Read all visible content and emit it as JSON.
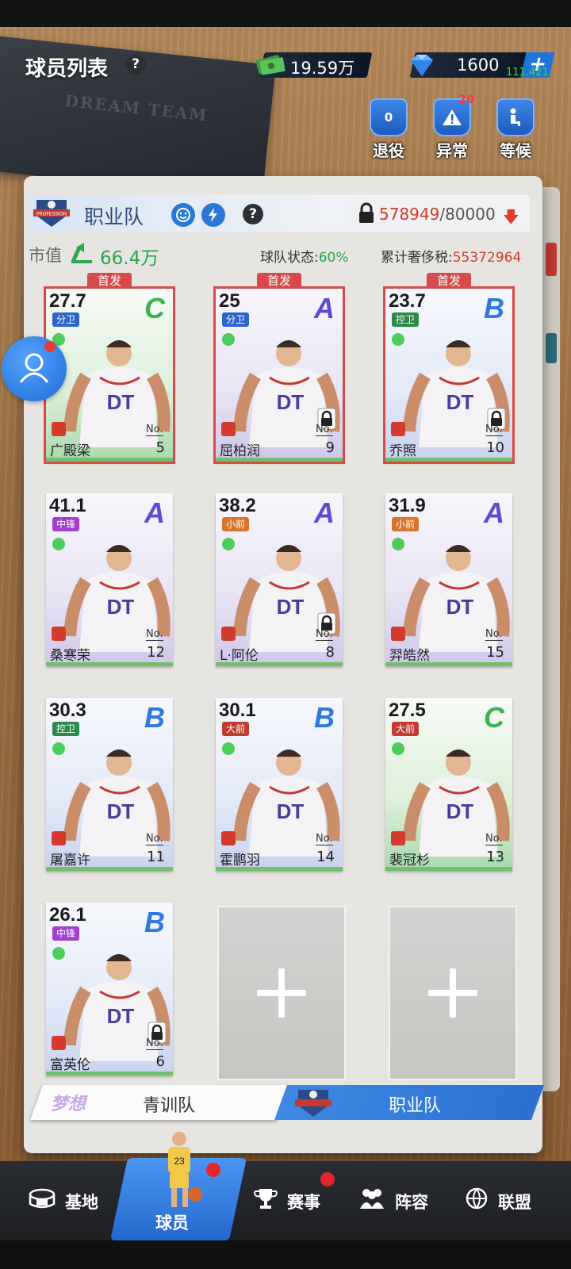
{
  "header": {
    "title": "球员列表",
    "help": "?",
    "money": "19.59万",
    "diamonds": "1600",
    "plus": "+",
    "fps": "111.421"
  },
  "top_actions": [
    {
      "label": "退役",
      "icon": "retire-icon",
      "icon_text": "0"
    },
    {
      "label": "异常",
      "icon": "warning-icon",
      "badge": "20"
    },
    {
      "label": "等候",
      "icon": "waiting-seat-icon"
    }
  ],
  "notebook_text": "DREAM TEAM",
  "team": {
    "name": "职业队",
    "help": "?",
    "salary_used": "578949",
    "salary_cap": "/80000",
    "market_value_label": "市值",
    "market_value": "66.4万",
    "state_label": "球队状态:",
    "state_value": "60%",
    "tax_label": "累计奢侈税:",
    "tax_value": "55372964"
  },
  "starter_tag": "首发",
  "no_label": "No.",
  "players": [
    {
      "rating": "27.7",
      "position": "分卫",
      "grade": "C",
      "name": "广殿梁",
      "number": "5",
      "starter": true,
      "locked": false
    },
    {
      "rating": "25",
      "position": "分卫",
      "grade": "A",
      "name": "屈柏润",
      "number": "9",
      "starter": true,
      "locked": true
    },
    {
      "rating": "23.7",
      "position": "控卫",
      "grade": "B",
      "name": "乔照",
      "number": "10",
      "starter": true,
      "locked": true
    },
    {
      "rating": "41.1",
      "position": "中锋",
      "grade": "A",
      "name": "桑寒荣",
      "number": "12",
      "starter": false,
      "locked": false
    },
    {
      "rating": "38.2",
      "position": "小前",
      "grade": "A",
      "name": "L·阿伦",
      "number": "8",
      "starter": false,
      "locked": true
    },
    {
      "rating": "31.9",
      "position": "小前",
      "grade": "A",
      "name": "羿皓然",
      "number": "15",
      "starter": false,
      "locked": false
    },
    {
      "rating": "30.3",
      "position": "控卫",
      "grade": "B",
      "name": "屠嘉许",
      "number": "11",
      "starter": false,
      "locked": false
    },
    {
      "rating": "30.1",
      "position": "大前",
      "grade": "B",
      "name": "霍鹏羽",
      "number": "14",
      "starter": false,
      "locked": false
    },
    {
      "rating": "27.5",
      "position": "大前",
      "grade": "C",
      "name": "裴冠杉",
      "number": "13",
      "starter": false,
      "locked": false
    },
    {
      "rating": "26.1",
      "position": "中锋",
      "grade": "B",
      "name": "富英伦",
      "number": "6",
      "starter": false,
      "locked": true
    }
  ],
  "segment_tabs": {
    "youth": "青训队",
    "pro": "职业队",
    "youth_logo_text": "梦想"
  },
  "bottom_nav": {
    "base": "基地",
    "players": "球员",
    "events": "赛事",
    "lineup": "阵容",
    "league": "联盟"
  },
  "jersey_text": "DT",
  "logo_text": "PROFESSION",
  "colors": {
    "accent_blue": "#2a78d6",
    "starter_red": "#d84a4a",
    "green": "#27a64a",
    "red": "#d23b2b"
  }
}
